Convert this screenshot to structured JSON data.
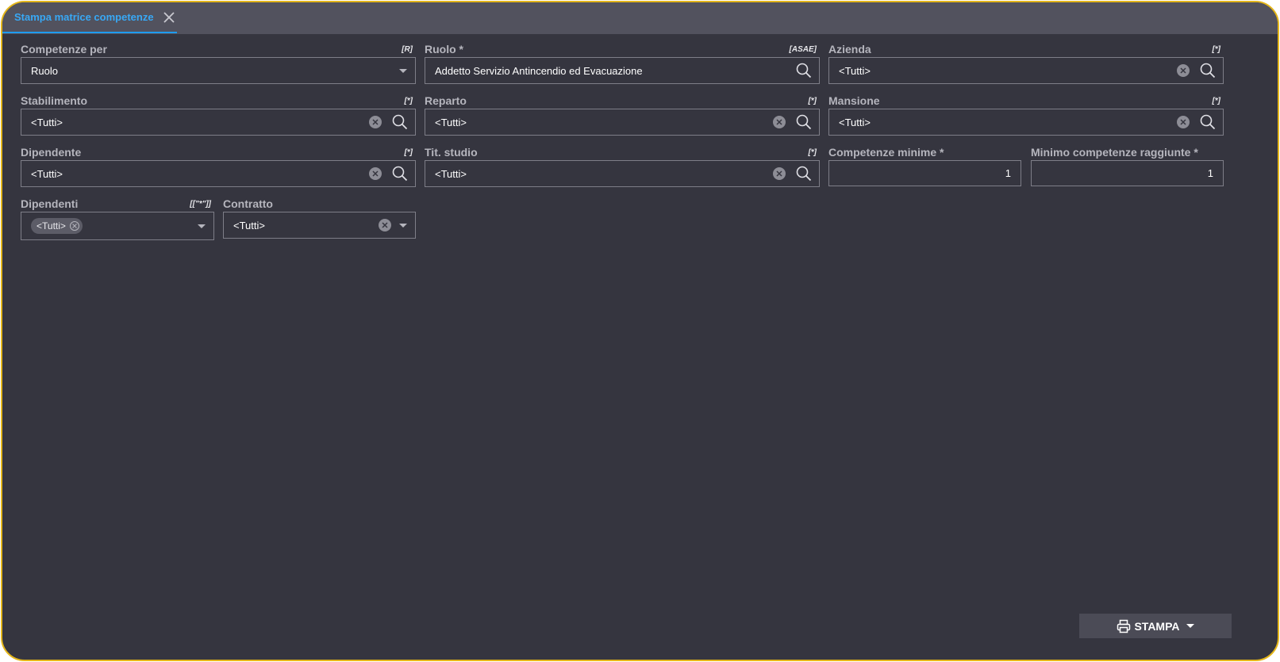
{
  "tab": {
    "title": "Stampa matrice competenze"
  },
  "fields": {
    "competenze_per": {
      "label": "Competenze per",
      "tag": "[R]",
      "value": "Ruolo"
    },
    "ruolo": {
      "label": "Ruolo *",
      "tag": "[ASAE]",
      "value": "Addetto Servizio Antincendio ed Evacuazione"
    },
    "azienda": {
      "label": "Azienda",
      "tag": "[*]",
      "value": "<Tutti>"
    },
    "stabilimento": {
      "label": "Stabilimento",
      "tag": "[*]",
      "value": "<Tutti>"
    },
    "reparto": {
      "label": "Reparto",
      "tag": "[*]",
      "value": "<Tutti>"
    },
    "mansione": {
      "label": "Mansione",
      "tag": "[*]",
      "value": "<Tutti>"
    },
    "dipendente": {
      "label": "Dipendente",
      "tag": "[*]",
      "value": "<Tutti>"
    },
    "tit_studio": {
      "label": "Tit. studio",
      "tag": "[*]",
      "value": "<Tutti>"
    },
    "competenze_minime": {
      "label": "Competenze minime *",
      "value": "1"
    },
    "minimo_competenze": {
      "label": "Minimo competenze raggiunte *",
      "value": "1"
    },
    "dipendenti": {
      "label": "Dipendenti",
      "tag": "[[\"*\"]]",
      "chip": "<Tutti>"
    },
    "contratto": {
      "label": "Contratto",
      "value": "<Tutti>"
    }
  },
  "actions": {
    "print_label": "STAMPA"
  },
  "colors": {
    "accent": "#1e9cf0",
    "frame": "#e4b61a",
    "background": "#35353f"
  }
}
